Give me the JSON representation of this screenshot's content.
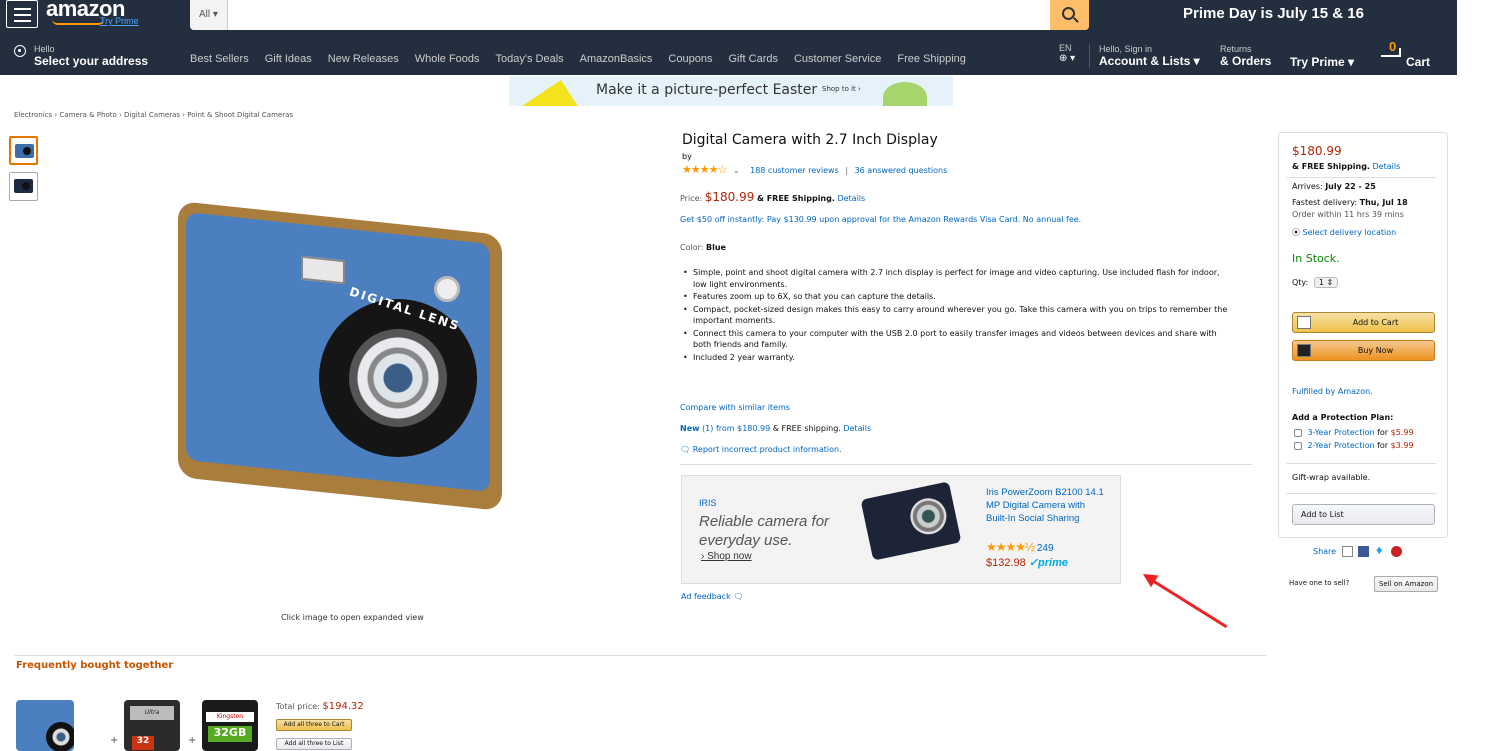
{
  "nav": {
    "logo": "amazon",
    "logo_sub": "Try Prime",
    "search_category": "All ▾",
    "search_placeholder": "",
    "promo": "Prime Day is July 15 & 16",
    "address_hello": "Hello",
    "address_main": "Select your address",
    "links": [
      "Best Sellers",
      "Gift Ideas",
      "New Releases",
      "Whole Foods",
      "Today's Deals",
      "AmazonBasics",
      "Coupons",
      "Gift Cards",
      "Customer Service",
      "Free Shipping"
    ],
    "lang_top": "EN",
    "lang_bottom": "⊕ ▾",
    "account_small": "Hello, Sign in",
    "account_big": "Account & Lists ▾",
    "orders_small": "Returns",
    "orders_big": "& Orders",
    "prime": "Try Prime ▾",
    "cart_count": "0",
    "cart_label": "Cart"
  },
  "banner": {
    "text": "Make it a picture-perfect Easter",
    "cta": "Shop to it ›"
  },
  "breadcrumb": "Electronics › Camera & Photo › Digital Cameras › Point & Shoot Digital Cameras",
  "gallery": {
    "camera_label": "DIGITAL LENS",
    "click_note": "Click image to open expanded view"
  },
  "product": {
    "title": "Digital Camera with 2.7 Inch Display",
    "by": "by",
    "stars": "★★★★☆",
    "star_rating": 4,
    "rating_caret": "⌄",
    "reviews": "188 customer reviews",
    "rating_separator": "|",
    "questions": "36 answered questions",
    "price_label": "Price:",
    "price": "$180.99",
    "shipping_prefix": "& FREE Shipping.",
    "shipping_details": "Details",
    "offer": "Get $50 off instantly: Pay $130.99 upon approval for the Amazon Rewards Visa Card. No annual fee.",
    "color_label": "Color:",
    "color_value": "Blue",
    "features": [
      "Simple, point and shoot digital camera with 2.7 inch display is perfect for image and video capturing. Use included flash for indoor, low light environments.",
      "Features zoom up to 6X, so that you can capture the details.",
      "Compact, pocket-sized design makes this easy to carry around wherever you go. Take this camera with you on trips to remember the important moments.",
      "Connect this camera to your computer with the USB 2.0 port to easily transfer images and videos between devices and share with both friends and family.",
      "Included 2 year warranty."
    ],
    "compare": "Compare with similar items",
    "new_label": "New",
    "new_count": "(1) from $180.99",
    "new_shipping": "& FREE shipping.",
    "new_details": "Details",
    "report": "Report incorrect product information."
  },
  "ad": {
    "brand": "IRIS",
    "tagline": "Reliable camera for everyday use.",
    "shop": "› Shop now",
    "name": "Iris PowerZoom B2100 14.1 MP Digital Camera with Built-In Social Sharing",
    "stars": "★★★★½",
    "star_rating": 4.5,
    "reviews": "249",
    "price": "$132.98",
    "prime": "✓prime",
    "feedback": "Ad feedback"
  },
  "buybox": {
    "price": "$180.99",
    "shipping": "& FREE Shipping.",
    "shipping_details": "Details",
    "arrives_label": "Arrives:",
    "arrives_value": "July 22 - 25",
    "fastest_label": "Fastest delivery:",
    "fastest_value": "Thu, Jul 18",
    "order_within": "Order within 11 hrs 39 mins",
    "delivery_location": "Select delivery location",
    "stock": "In Stock.",
    "qty_label": "Qty:",
    "qty_value": "1 ⇕",
    "add_to_cart": "Add to Cart",
    "buy_now": "Buy Now",
    "fulfilled": "Fulfilled by Amazon.",
    "protection_title": "Add a Protection Plan:",
    "plans": [
      {
        "label": "3-Year Protection",
        "for": "for",
        "price": "$5.99"
      },
      {
        "label": "2-Year Protection",
        "for": "for",
        "price": "$3.99"
      }
    ],
    "gift_wrap": "Gift-wrap available.",
    "add_to_list": "Add to List",
    "share": "Share",
    "sell_question": "Have one to sell?",
    "sell_button": "Sell on Amazon"
  },
  "fbt": {
    "title": "Frequently bought together",
    "total_label": "Total price:",
    "total_price": "$194.32",
    "add_all_cart": "Add all three to Cart",
    "add_all_list": "Add all three to List",
    "card1_brand": "Ultra",
    "card1_size": "32",
    "card2_brand": "Kingston",
    "card2_size": "32GB"
  },
  "colors": {
    "nav_bg": "#232f3e",
    "link": "#0066c0",
    "price": "#b12704",
    "accent": "#ff9900",
    "stock": "#008a00"
  }
}
